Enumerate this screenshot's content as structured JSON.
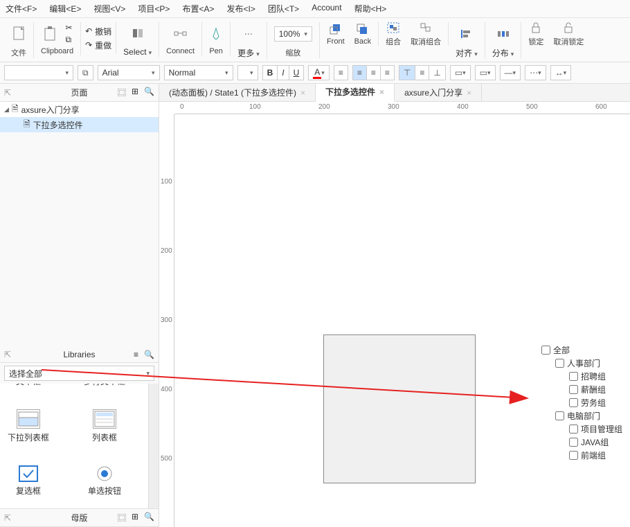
{
  "menu": {
    "file": "文件<F>",
    "edit": "编辑<E>",
    "view": "视图<V>",
    "project": "项目<P>",
    "arrange": "布置<A>",
    "publish": "发布<I>",
    "team": "团队<T>",
    "account": "Account",
    "help": "帮助<H>"
  },
  "ribbon": {
    "file": "文件",
    "clipboard": "Clipboard",
    "undo": "撤销",
    "redo": "重做",
    "select": "Select",
    "connect": "Connect",
    "pen": "Pen",
    "more": "更多",
    "zoom_val": "100%",
    "zoom": "缩放",
    "front": "Front",
    "back": "Back",
    "group": "组合",
    "ungroup": "取消组合",
    "align": "对齐",
    "distribute": "分布",
    "lock": "锁定",
    "unlock": "取消锁定"
  },
  "format": {
    "font": "Arial",
    "style": "Normal"
  },
  "panels": {
    "page": "页面",
    "libraries": "Libraries",
    "masters": "母版",
    "lib_sel": "选择全部"
  },
  "outline": {
    "root": "axsure入门分享",
    "child": "下拉多选控件"
  },
  "lib_items": {
    "txt1": "文本框",
    "txt2": "多行文本框",
    "dropdown": "下拉列表框",
    "listbox": "列表框",
    "checkbox": "复选框",
    "radio": "单选按钮"
  },
  "tabs": {
    "bg": "(动态面板) / State1 (下拉多选控件)",
    "active": "下拉多选控件",
    "other": "axsure入门分享"
  },
  "ruler_h": [
    "0",
    "100",
    "200",
    "300",
    "400",
    "500",
    "600"
  ],
  "ruler_v": [
    "100",
    "200",
    "300",
    "400",
    "500"
  ],
  "ck": {
    "all": "全部",
    "hr": "人事部门",
    "zhaopin": "招聘组",
    "xinchou": "薪酬组",
    "laowu": "劳务组",
    "it": "电脑部门",
    "pm": "项目管理组",
    "java": "JAVA组",
    "qd": "前端组"
  }
}
